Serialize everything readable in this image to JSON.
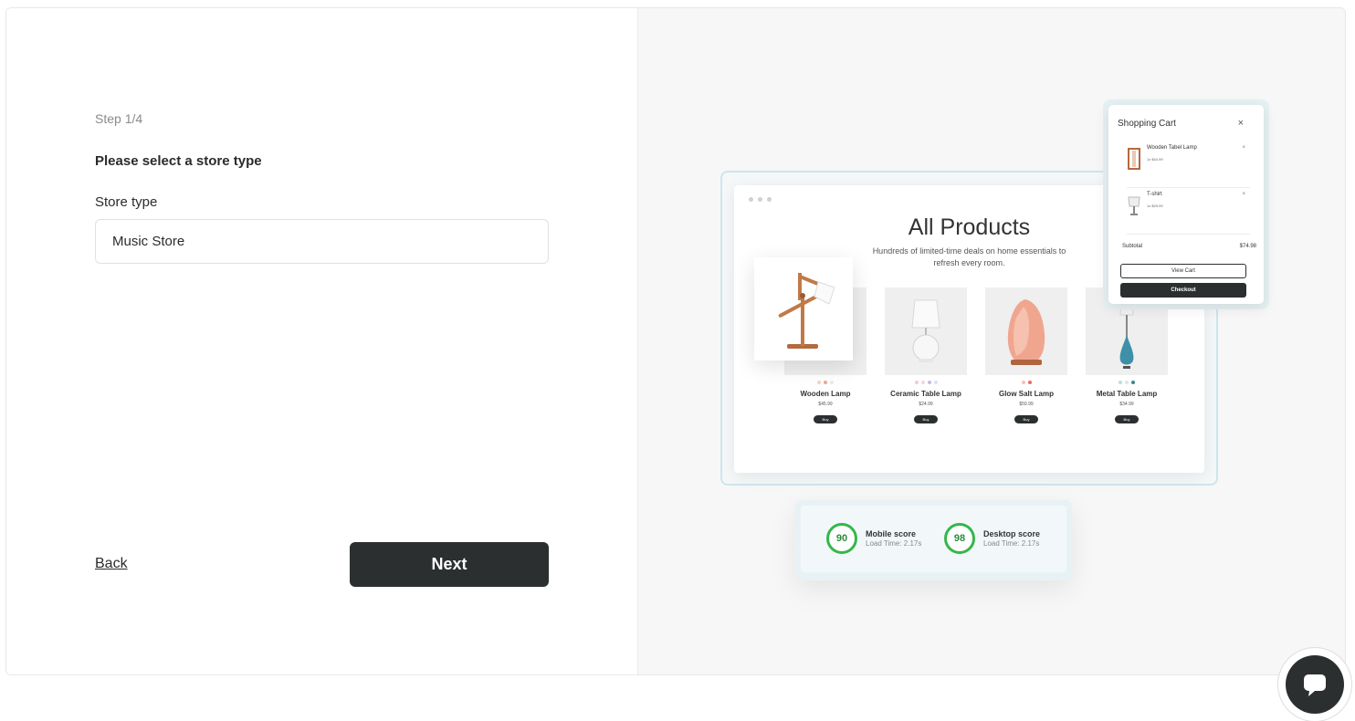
{
  "wizard": {
    "step": "Step 1/4",
    "heading": "Please select a store type",
    "store_type_label": "Store type",
    "store_type_value": "Music Store",
    "back_label": "Back",
    "next_label": "Next"
  },
  "preview": {
    "title": "All Products",
    "subtitle": "Hundreds of limited-time deals on home essentials to refresh every room.",
    "buy_label": "Buy",
    "products": [
      {
        "name": "Wooden Lamp",
        "price": "$45.99",
        "dots": [
          "#f3d3c8",
          "#f0a98c",
          "#e9e9e9"
        ]
      },
      {
        "name": "Ceramic Table Lamp",
        "price": "$24.99",
        "dots": [
          "#f5c9d0",
          "#f3d6e2",
          "#c9b9e6",
          "#d7e3f5"
        ]
      },
      {
        "name": "Glow Salt Lamp",
        "price": "$59.99",
        "dots": [
          "#f7c2b4",
          "#ef6b5a"
        ]
      },
      {
        "name": "Metal Table Lamp",
        "price": "$34.99",
        "dots": [
          "#b9dfd9",
          "#d8e8e4",
          "#3a8a87"
        ]
      }
    ],
    "cart": {
      "title": "Shopping Cart",
      "close": "×",
      "items": [
        {
          "name": "Wooden Tabel Lamp",
          "price": "1x $44.99",
          "remove": "×"
        },
        {
          "name": "T-shirt",
          "price": "1x $29.99",
          "remove": "×"
        }
      ],
      "subtotal_label": "Subtotal",
      "subtotal_value": "$74.98",
      "view_cart": "View Cart",
      "checkout": "Checkout"
    },
    "scores": [
      {
        "value": "90",
        "name": "Mobile score",
        "load": "Load Time: 2.17s"
      },
      {
        "value": "98",
        "name": "Desktop score",
        "load": "Load Time: 2.17s"
      }
    ],
    "score_color": "#35b74a"
  },
  "icons": {
    "chat": "chat-bubble-icon"
  }
}
